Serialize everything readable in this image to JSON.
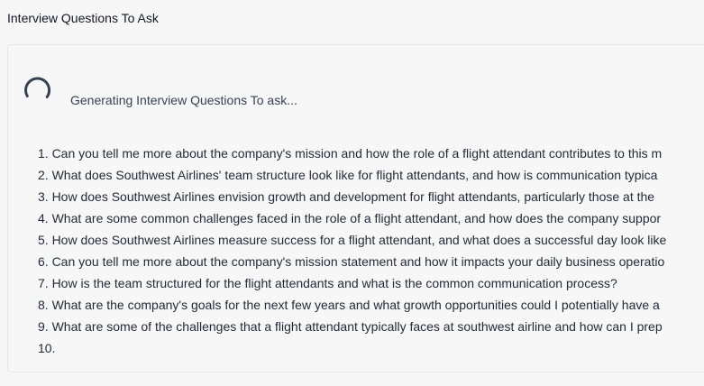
{
  "page": {
    "title": "Interview Questions To Ask"
  },
  "status": {
    "text": "Generating Interview Questions To ask...",
    "spinner_icon": "loading-spinner-icon"
  },
  "questions": [
    "1. Can you tell me more about the company's mission and how the role of a flight attendant contributes to this m",
    "2. What does Southwest Airlines' team structure look like for flight attendants, and how is communication typica",
    "3. How does Southwest Airlines envision growth and development for flight attendants, particularly those at the",
    "4. What are some common challenges faced in the role of a flight attendant, and how does the company suppor",
    "5. How does Southwest Airlines measure success for a flight attendant, and what does a successful day look like",
    "6. Can you tell me more about the company's mission statement and how it impacts your daily business operatio",
    "7. How is the team structured for the flight attendants and what is the common communication process?",
    "8. What are the company's goals for the next few years and what growth opportunities could I potentially have a",
    "9. What are some of the challenges that a flight attendant typically faces at southwest airline and how can I prep",
    "10."
  ]
}
